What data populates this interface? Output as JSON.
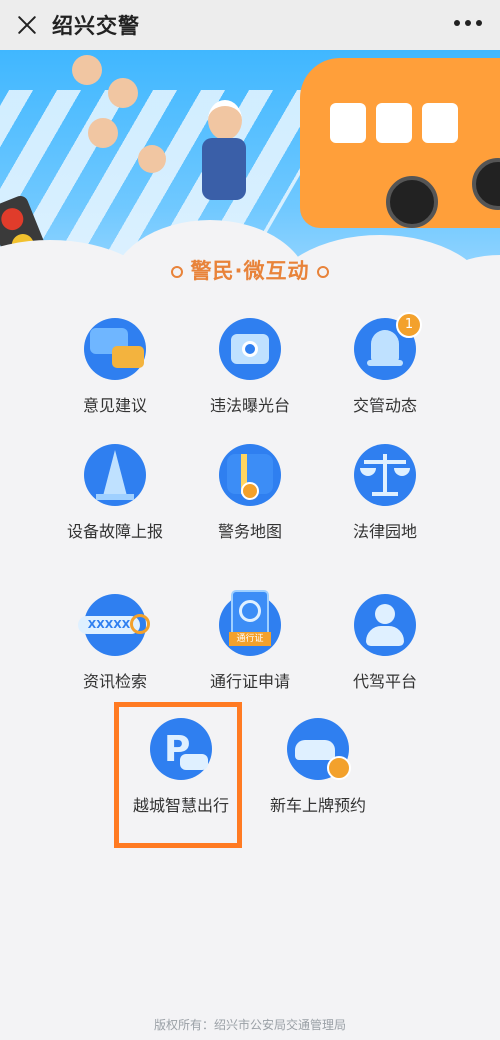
{
  "header": {
    "title": "绍兴交警"
  },
  "section": {
    "title": "警民·微互动"
  },
  "items": [
    {
      "label": "意见建议",
      "icon": "chat-bubbles-icon"
    },
    {
      "label": "违法曝光台",
      "icon": "camera-icon"
    },
    {
      "label": "交管动态",
      "icon": "bell-icon",
      "badge": "1"
    },
    {
      "label": "设备故障上报",
      "icon": "traffic-cone-icon"
    },
    {
      "label": "警务地图",
      "icon": "map-pin-icon"
    },
    {
      "label": "法律园地",
      "icon": "scales-icon"
    },
    {
      "label": "资讯检索",
      "icon": "search-box-icon",
      "icon_text": "XXXXX"
    },
    {
      "label": "通行证申请",
      "icon": "pass-document-icon",
      "icon_text": "通行证"
    },
    {
      "label": "代驾平台",
      "icon": "person-icon"
    },
    {
      "label": "越城智慧出行",
      "icon": "parking-car-icon",
      "icon_text": "P"
    },
    {
      "label": "新车上牌预约",
      "icon": "car-clock-icon"
    }
  ],
  "footer": {
    "text": "版权所有：绍兴市公安局交通管理局"
  },
  "colors": {
    "accent": "#e8833a",
    "icon_blue": "#2f7ff0",
    "highlight": "#ff7a22"
  }
}
